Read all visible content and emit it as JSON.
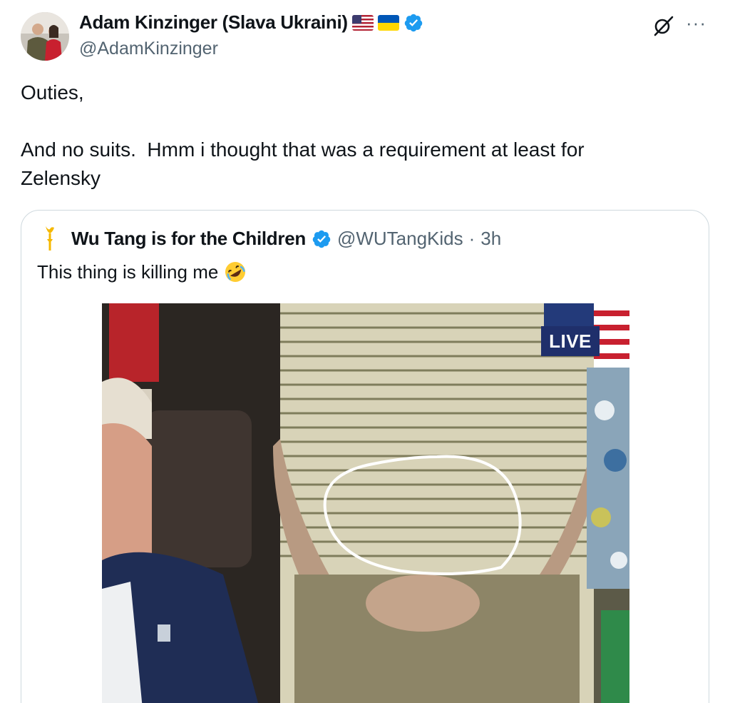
{
  "author": {
    "display_name": "Adam Kinzinger (Slava Ukraini)",
    "handle": "@AdamKinzinger",
    "flags": [
      "us-flag-icon",
      "ukraine-flag-icon"
    ],
    "verified": true
  },
  "tweet": {
    "text": "Outies,\n\nAnd no suits.  Hmm i thought that was a requirement at least for Zelensky"
  },
  "header_icons": {
    "grok": "grok-icon",
    "more": "···"
  },
  "quoted_tweet": {
    "display_name": "Wu Tang is for the Children",
    "handle": "@WUTangKids",
    "separator": "·",
    "time": "3h",
    "text": "This thing is killing me",
    "emoji": "rolling-on-floor-laughing-icon",
    "media": {
      "live_label": "LIVE"
    }
  },
  "colors": {
    "verified_blue": "#1d9bf0",
    "secondary_text": "#536471",
    "border": "#cfd9de",
    "live_badge": "#1f2f6b"
  }
}
